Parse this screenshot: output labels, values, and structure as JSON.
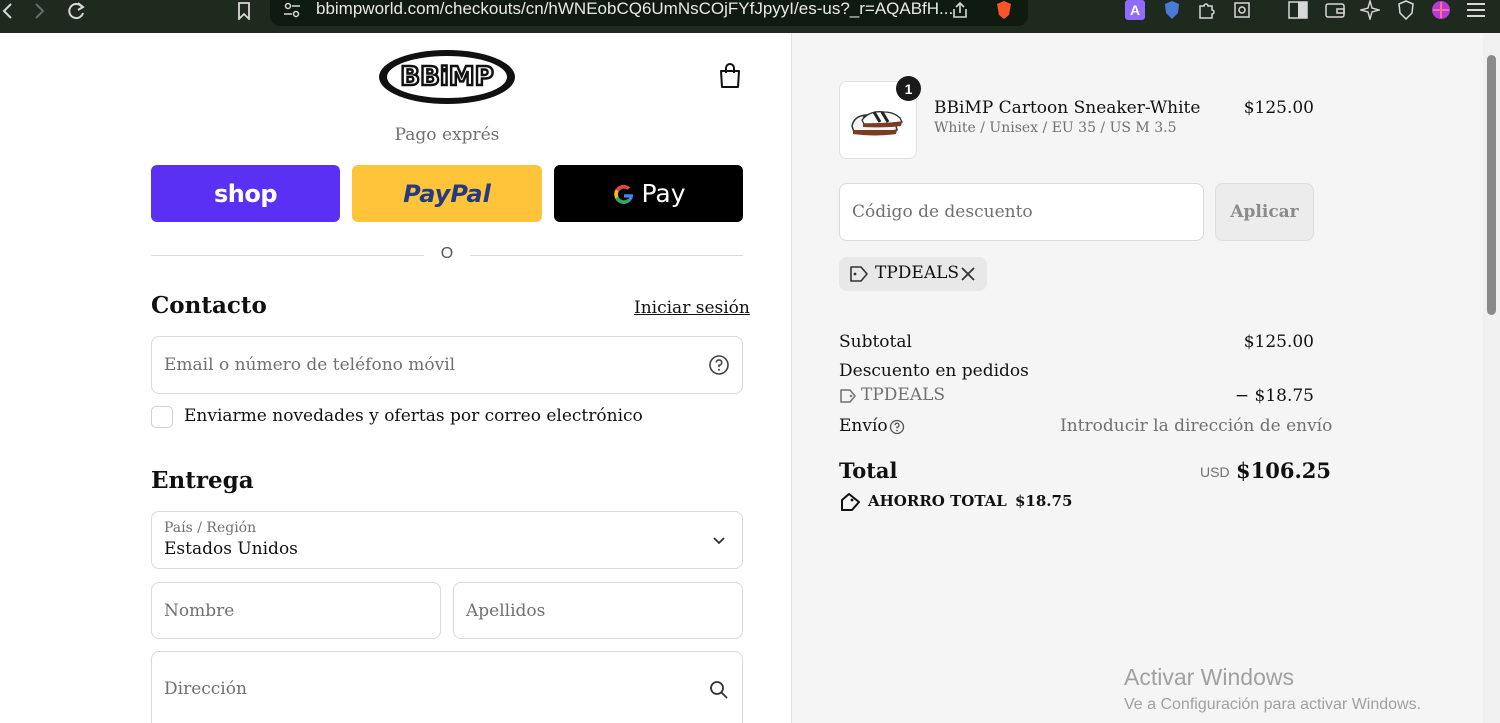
{
  "browser": {
    "url": "bbimpworld.com/checkouts/cn/hWNEobCQ6UmNsCOjFYfJpyyI/es-us?_r=AQABfH..."
  },
  "header": {
    "brand_name": "BBiMP",
    "express_label": "Pago exprés"
  },
  "express_buttons": {
    "shop_label": "shop",
    "paypal_label": "PayPal",
    "gpay_label": "Pay"
  },
  "divider_text": "O",
  "contact": {
    "title": "Contacto",
    "login_link": "Iniciar sesión",
    "email_placeholder": "Email o número de teléfono móvil",
    "newsletter_label": "Enviarme novedades y ofertas por correo electrónico",
    "newsletter_checked": false
  },
  "delivery": {
    "title": "Entrega",
    "country_label": "País / Región",
    "country_value": "Estados Unidos",
    "first_name_placeholder": "Nombre",
    "last_name_placeholder": "Apellidos",
    "address_placeholder": "Dirección"
  },
  "order": {
    "quantity": "1",
    "product_name": "BBiMP Cartoon Sneaker-White",
    "product_variant": "White / Unisex / EU 35 / US M 3.5",
    "product_price": "$125.00",
    "discount_placeholder": "Código de descuento",
    "apply_label": "Aplicar",
    "applied_code": "TPDEALS",
    "subtotal_label": "Subtotal",
    "subtotal_value": "$125.00",
    "order_discount_label": "Descuento en pedidos",
    "order_discount_code": "TPDEALS",
    "order_discount_value": "− $18.75",
    "shipping_label": "Envío",
    "shipping_value": "Introducir la dirección de envío",
    "total_label": "Total",
    "total_currency": "USD",
    "total_value": "$106.25",
    "savings_label": "AHORRO TOTAL",
    "savings_value": "$18.75"
  },
  "watermark": {
    "line1": "Activar Windows",
    "line2": "Ve a Configuración para activar Windows."
  },
  "colors": {
    "shop_purple": "#5a31f4",
    "paypal_yellow": "#ffc439",
    "gpay_black": "#000000",
    "browser_dark": "#1e2a1e"
  }
}
